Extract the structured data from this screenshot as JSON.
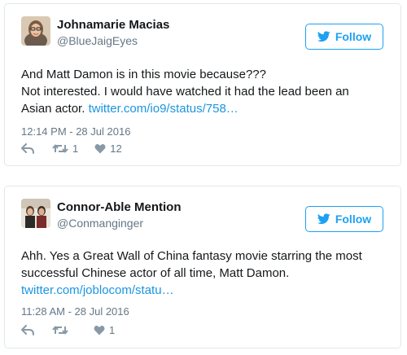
{
  "tweets": [
    {
      "name": "Johnamarie Macias",
      "handle": "@BlueJaigEyes",
      "follow_label": "Follow",
      "text_lines": [
        "And Matt Damon is in this movie because???",
        "Not interested. I would have watched it had the lead been an",
        "Asian actor."
      ],
      "link": "twitter.com/io9/status/758…",
      "timestamp": "12:14 PM - 28 Jul 2016",
      "retweets": "1",
      "likes": "12"
    },
    {
      "name": "Connor-Able Mention",
      "handle": "@Conmanginger",
      "follow_label": "Follow",
      "text_lines": [
        "Ahh. Yes a Great Wall of China fantasy movie starring the most",
        "successful Chinese actor of all time, Matt Damon."
      ],
      "link": "twitter.com/joblocom/statu…",
      "timestamp": "11:28 AM - 28 Jul 2016",
      "retweets": "",
      "likes": "1"
    }
  ],
  "colors": {
    "accent": "#1da1f2",
    "link": "#1b95e0",
    "muted": "#657786",
    "border": "#e1e8ed"
  },
  "icons": [
    "twitter-bird-icon",
    "reply-icon",
    "retweet-icon",
    "heart-icon"
  ]
}
